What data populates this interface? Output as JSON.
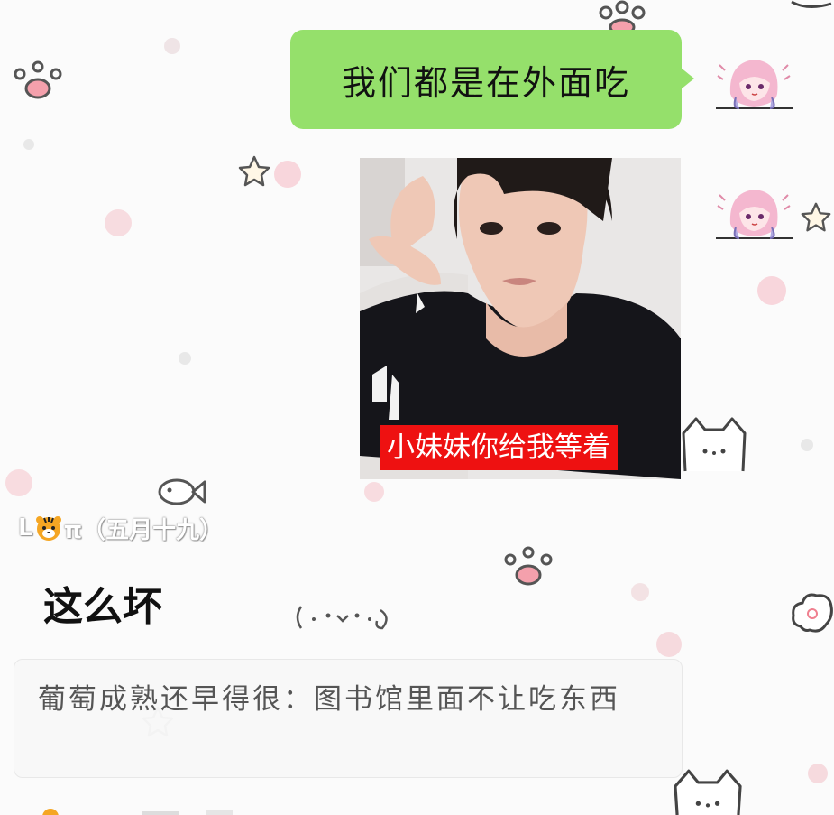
{
  "outgoing": [
    {
      "type": "text",
      "text": "我们都是在外面吃"
    },
    {
      "type": "image",
      "caption": "小妹妹你给我等着"
    }
  ],
  "incoming": {
    "sender_name": "L🐯π（五月十九）",
    "sender_name_parts": {
      "first": "L",
      "rest": "π（五月十九）"
    },
    "message": "这么坏",
    "quote": "葡萄成熟还早得很：图书馆里面不让吃东西"
  },
  "colors": {
    "bubble_green": "#95e06b",
    "caption_red": "#ee1111",
    "background": "#fbfbfb"
  },
  "icons": [
    "paw-icon",
    "star-icon",
    "fish-icon",
    "cat-face-icon",
    "cloud-icon",
    "tiger-emoji-icon",
    "avatar-icon"
  ]
}
